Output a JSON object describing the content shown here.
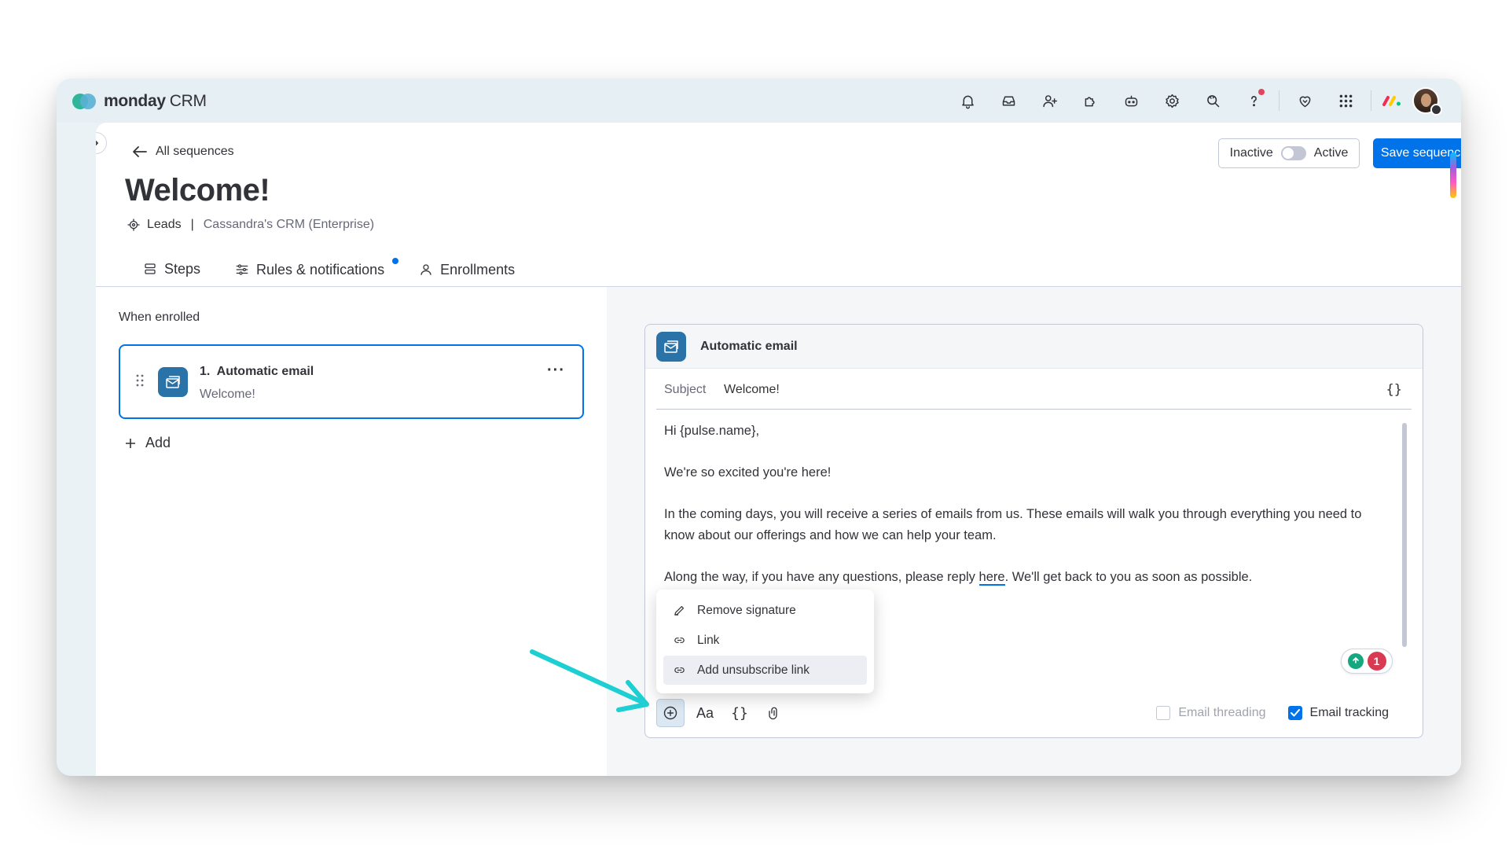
{
  "app": {
    "brand": "monday",
    "brand_sub": "CRM"
  },
  "colors": {
    "accent": "#0073ea",
    "step_icon": "#2a73a8",
    "annotation_arrow": "#1dcfd2",
    "notification_dot": "#e2445c",
    "grammar_badge": "#d83a52"
  },
  "topbar": {
    "icons": [
      "bell-icon",
      "inbox-icon",
      "invite-members-icon",
      "apps-icon",
      "ai-assistant-icon",
      "settings-icon",
      "search-icon",
      "help-icon",
      "favorites-icon",
      "app-switcher-icon"
    ]
  },
  "header": {
    "back_label": "All sequences",
    "title": "Welcome!",
    "board_name": "Leads",
    "workspace_name": "Cassandra's CRM (Enterprise)",
    "status_inactive": "Inactive",
    "status_active": "Active",
    "save_label": "Save sequence"
  },
  "tabs": [
    {
      "label": "Steps",
      "active": true,
      "icon": "steps-icon"
    },
    {
      "label": "Rules & notifications",
      "active": false,
      "icon": "sliders-icon",
      "has_dot": true
    },
    {
      "label": "Enrollments",
      "active": false,
      "icon": "person-icon"
    }
  ],
  "steps_panel": {
    "when_enrolled": "When enrolled",
    "steps": [
      {
        "number": "1.",
        "title": "Automatic email",
        "subtitle": "Welcome!"
      }
    ],
    "add_label": "Add"
  },
  "email_editor": {
    "header_title": "Automatic email",
    "subject_label": "Subject",
    "subject_value": "Welcome!",
    "braces": "{}",
    "body": {
      "greeting": "Hi  {pulse.name},",
      "para1": "We're so excited you're here!",
      "para2": "In the coming days, you will receive a series of emails from us. These emails will walk you through everything you need to know about our offerings and how we can help your team.",
      "para3_before": "Along the way, if you have any questions, please reply ",
      "para3_link": "here",
      "para3_after": ". We'll get back to you as soon as possible."
    },
    "grammar_count": "1",
    "insert_menu": [
      {
        "label": "Remove signature",
        "icon": "pencil-icon"
      },
      {
        "label": "Link",
        "icon": "link-icon"
      },
      {
        "label": "Add unsubscribe link",
        "icon": "link-icon",
        "highlighted": true
      }
    ],
    "toolbar": {
      "font_label": "Aa",
      "braces_label": "{}"
    },
    "email_threading_label": "Email threading",
    "email_threading_checked": false,
    "email_tracking_label": "Email tracking",
    "email_tracking_checked": true
  }
}
